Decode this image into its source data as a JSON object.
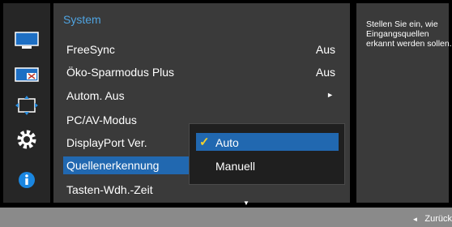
{
  "menu": {
    "title": "System",
    "items": [
      {
        "label": "FreeSync",
        "value": "Aus"
      },
      {
        "label": "Öko-Sparmodus Plus",
        "value": "Aus"
      },
      {
        "label": "Autom. Aus",
        "value": ""
      },
      {
        "label": "PC/AV-Modus",
        "value": ""
      },
      {
        "label": "DisplayPort Ver.",
        "value": ""
      },
      {
        "label": "Quellenerkennung",
        "value": ""
      },
      {
        "label": "Tasten-Wdh.-Zeit",
        "value": ""
      }
    ],
    "submenu_arrow": "►",
    "scroll_more": "▼"
  },
  "dropdown": {
    "options": [
      "Auto",
      "Manuell"
    ],
    "selected": "Auto",
    "check_mark": "✓"
  },
  "help": {
    "text": "Stellen Sie ein, wie\nEingangsquellen\nerkannt werden sollen."
  },
  "footer": {
    "back_arrow": "◄",
    "back_label": "Zurück"
  },
  "sidebar": {
    "icons": [
      "picture-icon",
      "screen-size-icon",
      "position-icon",
      "system-gear-icon",
      "info-icon"
    ]
  },
  "colors": {
    "accent": "#2168b0",
    "title": "#4fa3e0",
    "check": "#f2d22e"
  }
}
